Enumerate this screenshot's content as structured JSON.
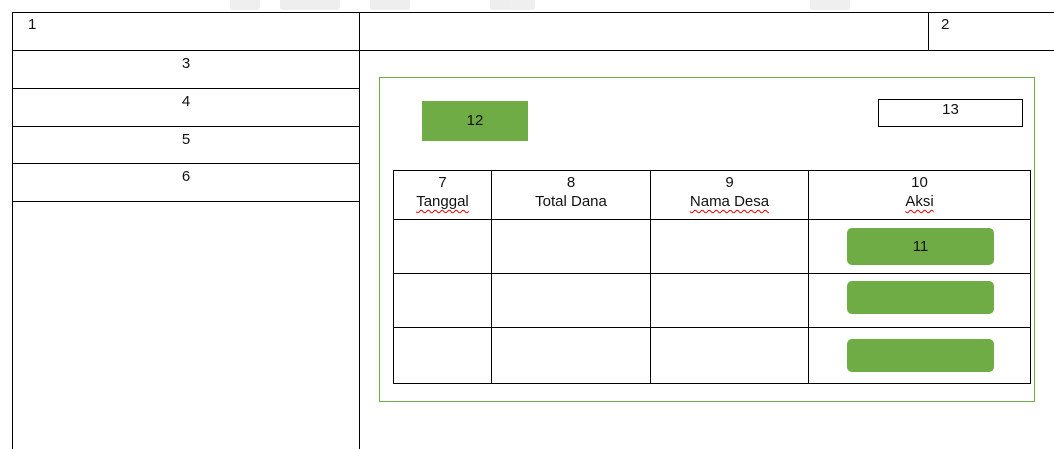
{
  "header": {
    "app_label": "1",
    "account_label": "2"
  },
  "sidebar": {
    "items": [
      {
        "label": "3"
      },
      {
        "label": "4"
      },
      {
        "label": "5"
      },
      {
        "label": "6"
      }
    ]
  },
  "toolbar": {
    "add_button_label": "12",
    "search_label": "13"
  },
  "table": {
    "columns": [
      {
        "number": "7",
        "label": "Tanggal"
      },
      {
        "number": "8",
        "label": "Total Dana"
      },
      {
        "number": "9",
        "label": "Nama Desa"
      },
      {
        "number": "10",
        "label": "Aksi"
      }
    ],
    "rows": [
      {
        "tanggal": "",
        "total_dana": "",
        "nama_desa": "",
        "action_label": "11"
      },
      {
        "tanggal": "",
        "total_dana": "",
        "nama_desa": "",
        "action_label": ""
      },
      {
        "tanggal": "",
        "total_dana": "",
        "nama_desa": "",
        "action_label": ""
      }
    ]
  },
  "colors": {
    "accent_green": "#6fac46",
    "panel_border": "#70ad47",
    "border": "#000000",
    "spellcheck_underline": "#dd0000"
  }
}
